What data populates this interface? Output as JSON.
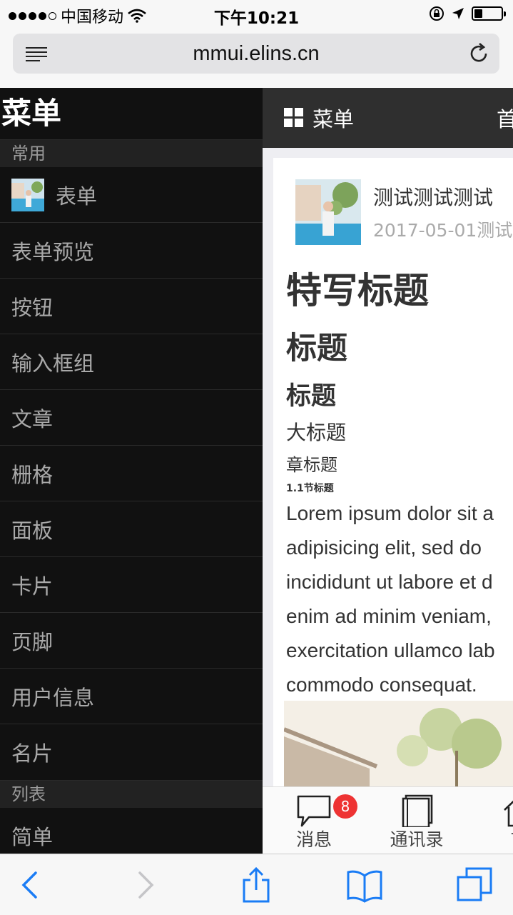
{
  "statusbar": {
    "carrier": "中国移动",
    "time": "下午10:21"
  },
  "browser": {
    "url": "mmui.elins.cn"
  },
  "sidebar": {
    "title": "菜单",
    "groups": [
      {
        "header": "常用",
        "items": [
          {
            "label": "表单"
          },
          {
            "label": "表单预览"
          },
          {
            "label": "按钮"
          },
          {
            "label": "输入框组"
          },
          {
            "label": "文章"
          },
          {
            "label": "栅格"
          },
          {
            "label": "面板"
          },
          {
            "label": "卡片"
          },
          {
            "label": "页脚"
          },
          {
            "label": "用户信息"
          },
          {
            "label": "名片"
          }
        ]
      },
      {
        "header": "列表",
        "items": [
          {
            "label": "简单"
          }
        ]
      }
    ]
  },
  "topbar": {
    "title": "菜单",
    "right_label": "首"
  },
  "article": {
    "author": "测试测试测试",
    "meta": "2017-05-01测试",
    "feature_title": "特写标题",
    "h1": "标题",
    "h2": "标题",
    "h3": "大标题",
    "h4": "章标题",
    "h5": "1.1节标题",
    "body_lines": [
      "Lorem ipsum dolor sit a",
      "adipisicing elit, sed do",
      "incididunt ut labore et d",
      "enim ad minim veniam,",
      "exercitation ullamco lab",
      "commodo consequat."
    ]
  },
  "tabbar": {
    "tabs": [
      {
        "label": "消息",
        "badge": "8"
      },
      {
        "label": "通讯录"
      },
      {
        "label": "首"
      }
    ]
  },
  "colors": {
    "sidebar_bg": "#111111",
    "topbar_bg": "#2f2f2f",
    "badge": "#ee3333",
    "safari_accent": "#1a7cf5"
  }
}
